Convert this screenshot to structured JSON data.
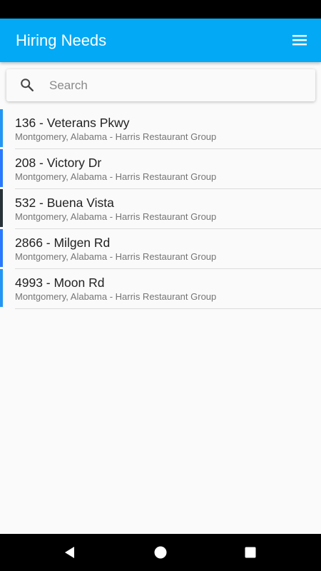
{
  "app_bar": {
    "title": "Hiring Needs",
    "menu_icon": "hamburger-menu-icon",
    "background": "#03a9f4"
  },
  "search": {
    "placeholder": "Search",
    "value": "",
    "icon": "search-icon"
  },
  "locations": [
    {
      "title": "136 - Veterans Pkwy",
      "subtitle": "Montgomery, Alabama - Harris Restaurant Group",
      "accent": "#2196f3"
    },
    {
      "title": "208 - Victory Dr",
      "subtitle": "Montgomery, Alabama - Harris Restaurant Group",
      "accent": "#2979ff"
    },
    {
      "title": "532 - Buena Vista",
      "subtitle": "Montgomery, Alabama - Harris Restaurant Group",
      "accent": "#263238"
    },
    {
      "title": "2866 - Milgen Rd",
      "subtitle": "Montgomery, Alabama - Harris Restaurant Group",
      "accent": "#2979ff"
    },
    {
      "title": "4993 - Moon Rd",
      "subtitle": "Montgomery, Alabama - Harris Restaurant Group",
      "accent": "#2196f3"
    }
  ],
  "nav_bar": {
    "back_icon": "back-triangle-icon",
    "home_icon": "home-circle-icon",
    "recents_icon": "recents-square-icon"
  }
}
